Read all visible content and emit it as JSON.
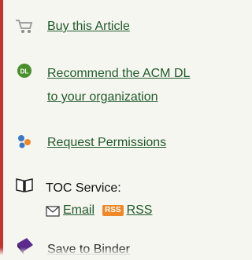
{
  "sidebar": {
    "items": {
      "buy": {
        "label": "Buy this Article",
        "icon": "cart-icon"
      },
      "recommend": {
        "label_line1": "Recommend the ACM DL",
        "label_line2": "to your organization",
        "icon": "dl-badge-icon"
      },
      "permissions": {
        "label": "Request Permissions",
        "icon": "molecules-icon"
      },
      "toc": {
        "label": "TOC Service:",
        "email_label": "Email",
        "rss_badge": "RSS",
        "rss_label": "RSS",
        "icon": "book-icon"
      },
      "binder": {
        "label": "Save to Binder",
        "icon": "binder-icon"
      }
    }
  },
  "colors": {
    "link": "#1f5a2b",
    "accent_rule": "#c8312f",
    "background": "#f6f6f0"
  }
}
